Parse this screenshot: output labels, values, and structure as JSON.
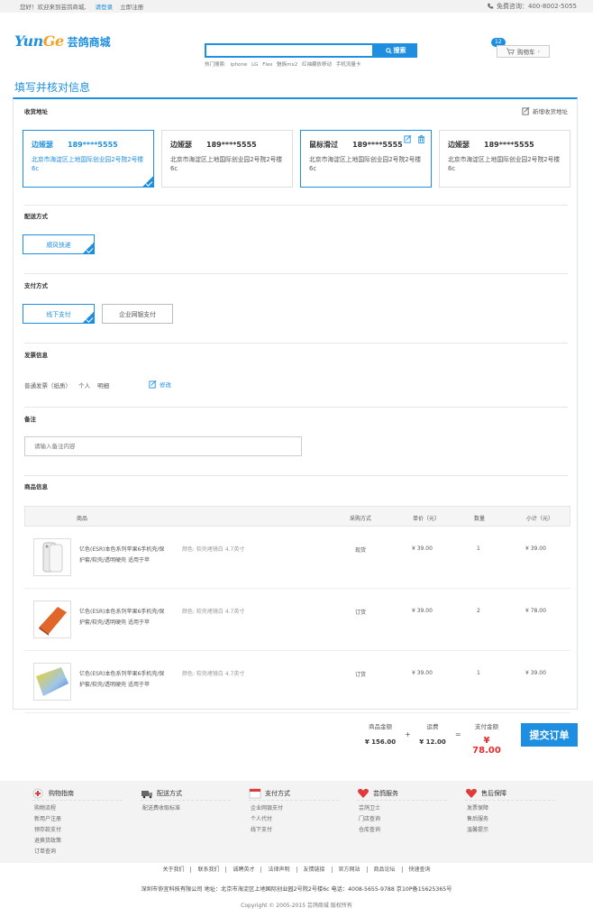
{
  "topbar": {
    "greeting": "您好！欢迎来到芸鸽商城,",
    "login": "请登录",
    "register": "立即注册",
    "phone": "免费咨询：400-8002-5055"
  },
  "logo": {
    "en_a": "Yun",
    "en_b": "Ge",
    "cn": "芸鸽商城"
  },
  "search": {
    "button": "搜索",
    "placeholder": "",
    "hot_label": "热门搜索:",
    "hot": [
      "iphone",
      "LG",
      "Flex",
      "魅族mx2",
      "红袖藏依移动",
      "手机流量卡"
    ]
  },
  "cart": {
    "label": "购物车",
    "count": "12"
  },
  "page_title": "填写并核对信息",
  "address": {
    "title": "收货地址",
    "new_label": "新增收货地址",
    "cards": [
      {
        "name": "边娅瑟",
        "phone": "189****5555",
        "addr": "北京市海淀区上地国际创业园2号院2号楼6c"
      },
      {
        "name": "边娅瑟",
        "phone": "189****5555",
        "addr": "北京市海淀区上地国际创业园2号院2号楼6c"
      },
      {
        "name": "鼠标滑过",
        "phone": "189****5555",
        "addr": "北京市海淀区上地国际创业园2号院2号楼6c"
      },
      {
        "name": "边娅瑟",
        "phone": "189****5555",
        "addr": "北京市海淀区上地国际创业园2号院2号楼6c"
      }
    ]
  },
  "delivery": {
    "title": "配送方式",
    "option": "顺风快递"
  },
  "payment": {
    "title": "支付方式",
    "options": [
      "线下支付",
      "企业网银支付"
    ]
  },
  "invoice": {
    "title": "发票信息",
    "type": "普通发票（纸质）",
    "who": "个人",
    "content": "明细",
    "edit": "修改"
  },
  "remark": {
    "title": "备注",
    "placeholder": "请输入备注内容"
  },
  "goods": {
    "title": "商品信息",
    "headers": {
      "product": "商品",
      "method": "采购方式",
      "price": "单价（元）",
      "qty": "数量",
      "subtotal": "小计（元）"
    },
    "rows": [
      {
        "name": "亿色(ESR)本色系列苹果6手机壳/保护套/软壳/透明硬壳 适用于苹",
        "attr": "颜色: 软壳堵镜白  4.7英寸",
        "method": "现货",
        "price": "¥ 39.00",
        "qty": "1",
        "subtotal": "¥ 39.00"
      },
      {
        "name": "亿色(ESR)本色系列苹果6手机壳/保护套/软壳/透明硬壳 适用于苹",
        "attr": "颜色: 软壳堵镜白  4.7英寸",
        "method": "订货",
        "price": "¥ 39.00",
        "qty": "2",
        "subtotal": "¥ 78.00"
      },
      {
        "name": "亿色(ESR)本色系列苹果6手机壳/保护套/软壳/透明硬壳 适用于苹",
        "attr": "颜色: 软壳堵镜白  4.7英寸",
        "method": "订货",
        "price": "¥ 39.00",
        "qty": "1",
        "subtotal": "¥ 39.00"
      }
    ]
  },
  "summary": {
    "goods_label": "商品金额",
    "goods_value": "¥ 156.00",
    "plus": "+",
    "freight_label": "运费",
    "freight_value": "¥ 12.00",
    "equals": "=",
    "pay_label": "支付金额",
    "pay_value": "¥ 78.00",
    "submit": "提交订单"
  },
  "footer": {
    "cols": [
      {
        "title": "购物指南",
        "items": [
          "购物流程",
          "新用户注册",
          "预存款支付",
          "退换货政策",
          "订单查询"
        ],
        "color": "#e03a3a"
      },
      {
        "title": "配送方式",
        "items": [
          "配送费收取标准"
        ],
        "color": "#555555"
      },
      {
        "title": "支付方式",
        "items": [
          "企业网银支付",
          "个人代付",
          "线下支付"
        ],
        "color": "#e03a3a"
      },
      {
        "title": "芸鸽服务",
        "items": [
          "芸鸽卫士",
          "门店查询",
          "仓库查询"
        ],
        "color": "#e03a3a"
      },
      {
        "title": "售后保障",
        "items": [
          "发票保障",
          "售后服务",
          "温馨提示"
        ],
        "color": "#e03a3a"
      }
    ],
    "links": [
      "关于我们",
      "联系我们",
      "诚聘英才",
      "法律声明",
      "友情链接",
      "官方网站",
      "商品论坛",
      "快速查询"
    ],
    "company": "深圳市协宜科技有限公司  地址：北京市海淀区上地国际创业园2号院2号楼6c  电话：4008-5655-9788  京10P备15625365号",
    "copyright": "Copyright © 2005-2015 芸鸽商城 版权所有"
  }
}
